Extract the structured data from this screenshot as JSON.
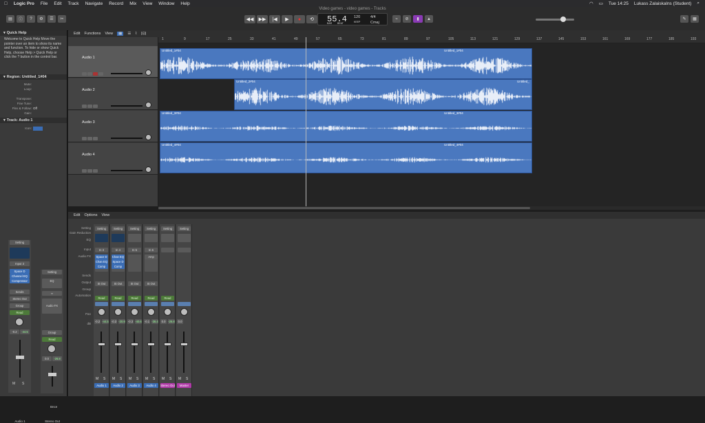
{
  "menubar": {
    "app": "Logic Pro",
    "items": [
      "File",
      "Edit",
      "Track",
      "Navigate",
      "Record",
      "Mix",
      "View",
      "Window",
      "Help"
    ],
    "clock": "Tue 14:25",
    "user": "Lukass Zalaiskalns (Student)"
  },
  "window": {
    "title": "Video games - video games - Tracks"
  },
  "lcd": {
    "position": "55.4",
    "tempo": "120",
    "tempo_label": "KEEP",
    "signature": "4/4",
    "key": "Cmaj",
    "bar_label": "BAR",
    "beat_label": "BEAT"
  },
  "inspector": {
    "quickhelp_title": "Quick Help",
    "quickhelp_body": "Welcome to Quick Help Move the pointer over an item to show its name and function. To hide or show Quick Help, choose Help > Quick Help or click the ? button in the control bar.",
    "region_title": "Region: Untitled_1#04",
    "region_params": [
      {
        "k": "Mute:",
        "v": ""
      },
      {
        "k": "Loop:",
        "v": ""
      },
      {
        "k": "Transpose:",
        "v": ""
      },
      {
        "k": "Fine Tune:",
        "v": ""
      },
      {
        "k": "Flex & Follow:",
        "v": "Off"
      },
      {
        "k": "Gain:",
        "v": ""
      }
    ],
    "track_title": "Track: Audio 1",
    "icon_label": "Icon:",
    "strip1": {
      "setting": "Setting",
      "input": "Input 3",
      "fx": [
        "Space D",
        "Channel EQ",
        "Compressor"
      ],
      "sends": "Sends",
      "output": "Stereo Out",
      "group": "Group",
      "automation": "Read",
      "vol": "-0.2",
      "peak": "-44.5",
      "name": "Audio 1"
    },
    "strip2": {
      "setting": "Setting",
      "eq": "EQ",
      "audio_fx": "Audio FX",
      "group": "Group",
      "automation": "Read",
      "vol": "0.0",
      "peak": "-26.8",
      "bnce": "Bnce",
      "name": "Stereo Out"
    }
  },
  "tracks_toolbar": {
    "items": [
      "Edit",
      "Functions",
      "View"
    ]
  },
  "ruler": {
    "marks": [
      "1",
      "9",
      "17",
      "25",
      "33",
      "41",
      "49",
      "57",
      "65",
      "73",
      "81",
      "89",
      "97",
      "105",
      "113",
      "121",
      "129",
      "137",
      "145",
      "153",
      "161",
      "169",
      "177",
      "185",
      "193"
    ]
  },
  "tracks": [
    {
      "name": "Audio 1",
      "regions": [
        "Untitled_1#04",
        "Untitled_1#04"
      ]
    },
    {
      "name": "Audio 2",
      "regions": [
        "Untitled_2#04",
        "Untitled_"
      ]
    },
    {
      "name": "Audio 3",
      "regions": [
        "Untitled_3#04",
        "Untitled_3#04"
      ]
    },
    {
      "name": "Audio 4",
      "regions": [
        "Untitled_4#04",
        "Untitled_4#04"
      ]
    }
  ],
  "mixer_toolbar": {
    "items": [
      "Edit",
      "Options",
      "View"
    ]
  },
  "mixer_labels": [
    "Setting",
    "Gain Reduction",
    "EQ",
    "Input",
    "Audio FX",
    "Sends",
    "Output",
    "Group",
    "Automation",
    "Pan",
    "dB"
  ],
  "strips": [
    {
      "input": "In 3",
      "fx": [
        "Space D",
        "Chan EQ",
        "Comp"
      ],
      "output": "St Out",
      "auto": "Read",
      "vol": "-0.2",
      "peak": "-44.5",
      "name": "Audio 1",
      "color": "#3a6db5"
    },
    {
      "input": "In 4",
      "fx": [
        "Chan EQ",
        "Space D",
        "Comp"
      ],
      "output": "St Out",
      "auto": "Read",
      "vol": "-0.3",
      "peak": "-20.9",
      "name": "Audio 2",
      "color": "#3a6db5"
    },
    {
      "input": "In 5",
      "fx": [],
      "output": "St Out",
      "auto": "Read",
      "vol": "-0.3",
      "peak": "-40.6",
      "name": "Audio 3",
      "color": "#3a6db5"
    },
    {
      "input": "In 6",
      "fx": [
        "Amp"
      ],
      "output": "St Out",
      "auto": "Read",
      "vol": "-0.1",
      "peak": "-38.4",
      "name": "Audio 4",
      "color": "#3a6db5"
    },
    {
      "input": "",
      "fx": [],
      "output": "",
      "auto": "Read",
      "vol": "0.0",
      "peak": "-26.8",
      "name": "Stereo Out",
      "color": "#b03aa8"
    },
    {
      "input": "",
      "fx": [],
      "output": "",
      "auto": "",
      "vol": "0.0",
      "peak": "",
      "name": "Master",
      "color": "#b03aa8"
    }
  ],
  "setting_label": "Setting",
  "colors": {
    "region": "#4a78bf",
    "accent": "#8a3ab5"
  }
}
